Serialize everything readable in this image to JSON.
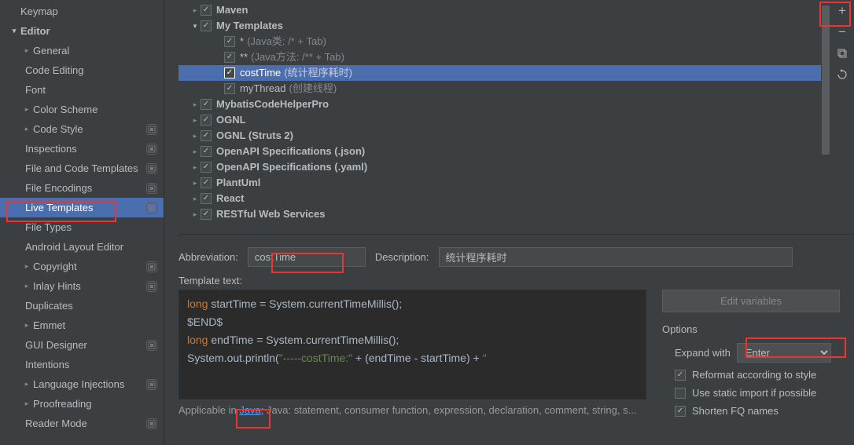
{
  "sidebar": {
    "items": [
      {
        "label": "Keymap",
        "depth": 0,
        "chev": "",
        "bold": false,
        "badge": false,
        "selected": false
      },
      {
        "label": "Editor",
        "depth": 0,
        "chev": "down",
        "bold": true,
        "badge": false,
        "selected": false
      },
      {
        "label": "General",
        "depth": 1,
        "chev": "right",
        "bold": false,
        "badge": false,
        "selected": false
      },
      {
        "label": "Code Editing",
        "depth": 2,
        "chev": "",
        "bold": false,
        "badge": false,
        "selected": false
      },
      {
        "label": "Font",
        "depth": 2,
        "chev": "",
        "bold": false,
        "badge": false,
        "selected": false
      },
      {
        "label": "Color Scheme",
        "depth": 1,
        "chev": "right",
        "bold": false,
        "badge": false,
        "selected": false
      },
      {
        "label": "Code Style",
        "depth": 1,
        "chev": "right",
        "bold": false,
        "badge": true,
        "selected": false
      },
      {
        "label": "Inspections",
        "depth": 2,
        "chev": "",
        "bold": false,
        "badge": true,
        "selected": false
      },
      {
        "label": "File and Code Templates",
        "depth": 2,
        "chev": "",
        "bold": false,
        "badge": true,
        "selected": false
      },
      {
        "label": "File Encodings",
        "depth": 2,
        "chev": "",
        "bold": false,
        "badge": true,
        "selected": false
      },
      {
        "label": "Live Templates",
        "depth": 2,
        "chev": "",
        "bold": false,
        "badge": true,
        "selected": true
      },
      {
        "label": "File Types",
        "depth": 2,
        "chev": "",
        "bold": false,
        "badge": false,
        "selected": false
      },
      {
        "label": "Android Layout Editor",
        "depth": 2,
        "chev": "",
        "bold": false,
        "badge": false,
        "selected": false
      },
      {
        "label": "Copyright",
        "depth": 1,
        "chev": "right",
        "bold": false,
        "badge": true,
        "selected": false
      },
      {
        "label": "Inlay Hints",
        "depth": 1,
        "chev": "right",
        "bold": false,
        "badge": true,
        "selected": false
      },
      {
        "label": "Duplicates",
        "depth": 2,
        "chev": "",
        "bold": false,
        "badge": false,
        "selected": false
      },
      {
        "label": "Emmet",
        "depth": 1,
        "chev": "right",
        "bold": false,
        "badge": false,
        "selected": false
      },
      {
        "label": "GUI Designer",
        "depth": 2,
        "chev": "",
        "bold": false,
        "badge": true,
        "selected": false
      },
      {
        "label": "Intentions",
        "depth": 2,
        "chev": "",
        "bold": false,
        "badge": false,
        "selected": false
      },
      {
        "label": "Language Injections",
        "depth": 1,
        "chev": "right",
        "bold": false,
        "badge": true,
        "selected": false
      },
      {
        "label": "Proofreading",
        "depth": 1,
        "chev": "right",
        "bold": false,
        "badge": false,
        "selected": false
      },
      {
        "label": "Reader Mode",
        "depth": 2,
        "chev": "",
        "bold": false,
        "badge": true,
        "selected": false
      }
    ]
  },
  "tree": {
    "rows": [
      {
        "label": "Maven",
        "suffix": "",
        "depth": 0,
        "chev": "right",
        "checked": true,
        "bold": true,
        "selected": false
      },
      {
        "label": "My Templates",
        "suffix": "",
        "depth": 0,
        "chev": "down",
        "checked": true,
        "bold": true,
        "selected": false
      },
      {
        "label": "*",
        "suffix": "(Java类: /* + Tab)",
        "depth": 1,
        "chev": "",
        "checked": true,
        "bold": false,
        "selected": false
      },
      {
        "label": "**",
        "suffix": "(Java方法: /** + Tab)",
        "depth": 1,
        "chev": "",
        "checked": true,
        "bold": false,
        "selected": false
      },
      {
        "label": "costTime",
        "suffix": "(统计程序耗时)",
        "depth": 1,
        "chev": "",
        "checked": true,
        "bold": false,
        "selected": true
      },
      {
        "label": "myThread",
        "suffix": "(创建线程)",
        "depth": 1,
        "chev": "",
        "checked": true,
        "bold": false,
        "selected": false
      },
      {
        "label": "MybatisCodeHelperPro",
        "suffix": "",
        "depth": 0,
        "chev": "right",
        "checked": true,
        "bold": true,
        "selected": false
      },
      {
        "label": "OGNL",
        "suffix": "",
        "depth": 0,
        "chev": "right",
        "checked": true,
        "bold": true,
        "selected": false
      },
      {
        "label": "OGNL (Struts 2)",
        "suffix": "",
        "depth": 0,
        "chev": "right",
        "checked": true,
        "bold": true,
        "selected": false
      },
      {
        "label": "OpenAPI Specifications (.json)",
        "suffix": "",
        "depth": 0,
        "chev": "right",
        "checked": true,
        "bold": true,
        "selected": false
      },
      {
        "label": "OpenAPI Specifications (.yaml)",
        "suffix": "",
        "depth": 0,
        "chev": "right",
        "checked": true,
        "bold": true,
        "selected": false
      },
      {
        "label": "PlantUml",
        "suffix": "",
        "depth": 0,
        "chev": "right",
        "checked": true,
        "bold": true,
        "selected": false
      },
      {
        "label": "React",
        "suffix": "",
        "depth": 0,
        "chev": "right",
        "checked": true,
        "bold": true,
        "selected": false
      },
      {
        "label": "RESTful Web Services",
        "suffix": "",
        "depth": 0,
        "chev": "right",
        "checked": true,
        "bold": true,
        "selected": false
      }
    ]
  },
  "toolbar": {
    "add": "+",
    "remove": "−",
    "copy_icon": "copy",
    "revert_icon": "revert"
  },
  "form": {
    "abbr_label": "Abbreviation:",
    "abbr_value": "costTime",
    "desc_label": "Description:",
    "desc_value": "统计程序耗时",
    "tmpl_label": "Template text:",
    "edit_vars": "Edit variables",
    "applicable_prefix": "Applicable in ",
    "applicable_link": "Java",
    "applicable_suffix": "; Java: statement, consumer function, expression, declaration, comment, string, s..."
  },
  "code": {
    "l1_kw": "long ",
    "l1_rest": "startTime = System.currentTimeMillis();",
    "l2": "$END$",
    "l3_kw": "long ",
    "l3_rest": "endTime = System.currentTimeMillis();",
    "l4_a": "System.out.println(",
    "l4_str": "\"-----costTime:\"",
    "l4_b": " + (endTime - startTime) + ",
    "l4_str2": "\" "
  },
  "options": {
    "title": "Options",
    "expand_label": "Expand with",
    "expand_value": "Enter",
    "reformat": {
      "label": "Reformat according to style",
      "checked": true
    },
    "static_import": {
      "label": "Use static import if possible",
      "checked": false
    },
    "shorten": {
      "label": "Shorten FQ names",
      "checked": true
    }
  }
}
